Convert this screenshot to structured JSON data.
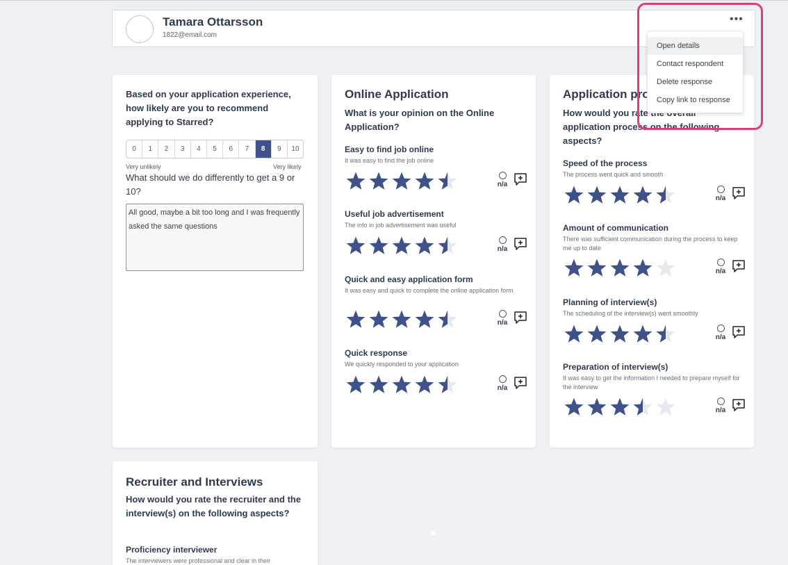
{
  "profile": {
    "name": "Tamara Ottarsson",
    "email": "1822@email.com"
  },
  "menu": {
    "more_icon": "more-horizontal-icon",
    "items": [
      "Open details",
      "Contact respondent",
      "Delete response",
      "Copy link to response"
    ]
  },
  "colors": {
    "star": "#3e5188",
    "star_empty": "#e6e8f0",
    "highlight": "#d83f7c",
    "nps_selected": "#3e5188"
  },
  "nps_card": {
    "question": "Based on your application experience, how likely are you to recommend applying to Starred?",
    "scale": [
      "0",
      "1",
      "2",
      "3",
      "4",
      "5",
      "6",
      "7",
      "8",
      "9",
      "10"
    ],
    "selected": "8",
    "label_low": "Very unlikely",
    "label_high": "Very likely",
    "followup_question": "What should we do differently to get a 9 or 10?",
    "answer": "All good, maybe a bit too long and I was frequently asked the same questions"
  },
  "online_card": {
    "title": "Online Application",
    "question": "What is your opinion on the Online Application?",
    "items": [
      {
        "title": "Easy to find job online",
        "desc": "It was easy to find the job online",
        "rating": 4.5,
        "na": "n/a"
      },
      {
        "title": "Useful job advertisement",
        "desc": "The info in job advertisement was useful",
        "rating": 4.5,
        "na": "n/a"
      },
      {
        "title": "Quick and easy application form",
        "desc": "It was easy and quick to complete the online application form",
        "rating": 4.5,
        "na": "n/a"
      },
      {
        "title": "Quick response",
        "desc": "We quickly responded to your application",
        "rating": 4.5,
        "na": "n/a"
      }
    ]
  },
  "process_card": {
    "title": "Application process",
    "question": "How would you rate the overall application process on the following aspects?",
    "items": [
      {
        "title": "Speed of the process",
        "desc": "The process went quick and smooth",
        "rating": 4.5,
        "na": "n/a"
      },
      {
        "title": "Amount of communication",
        "desc": "There was sufficient communication during the process to keep me up to date",
        "rating": 4,
        "na": "n/a"
      },
      {
        "title": "Planning of interview(s)",
        "desc": "The scheduling of the interview(s) went smoothly",
        "rating": 4.5,
        "na": "n/a"
      },
      {
        "title": "Preparation of interview(s)",
        "desc": "It was easy to get the information I needed to prepare myself for the interview",
        "rating": 3.5,
        "na": "n/a"
      }
    ]
  },
  "recruiter_card": {
    "title": "Recruiter and Interviews",
    "question": "How would you rate the recruiter and the interview(s) on the following aspects?",
    "items": [
      {
        "title": "Proficiency interviewer",
        "desc": "The interviewers were professional and clear in their"
      }
    ]
  }
}
